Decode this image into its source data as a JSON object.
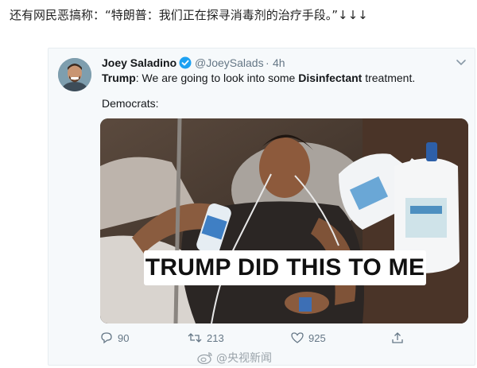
{
  "caption": "还有网民恶搞称：“特朗普：我们正在探寻消毒剂的治疗手段。”↓↓↓",
  "tweet": {
    "author_name": "Joey Saladino",
    "handle": "@JoeySalads",
    "separator": "·",
    "time": "4h",
    "line1_prefix": "Trump",
    "line1_mid": ": We are going to look into some ",
    "line1_bold": "Disinfectant",
    "line1_suffix": " treatment.",
    "line2": "Democrats:",
    "meme_text": "TRUMP DID THIS TO ME",
    "counts": {
      "replies": "90",
      "retweets": "213",
      "likes": "925"
    }
  },
  "icons": {
    "verified": "verified-badge-icon",
    "menu": "chevron-down-icon",
    "reply": "reply-icon",
    "retweet": "retweet-icon",
    "like": "heart-icon",
    "share": "share-icon",
    "watermark": "weibo-icon"
  },
  "watermark": "@央视新闻",
  "colors": {
    "accent": "#1da1f2",
    "muted": "#657786",
    "card_bg": "#f6f9fb"
  }
}
